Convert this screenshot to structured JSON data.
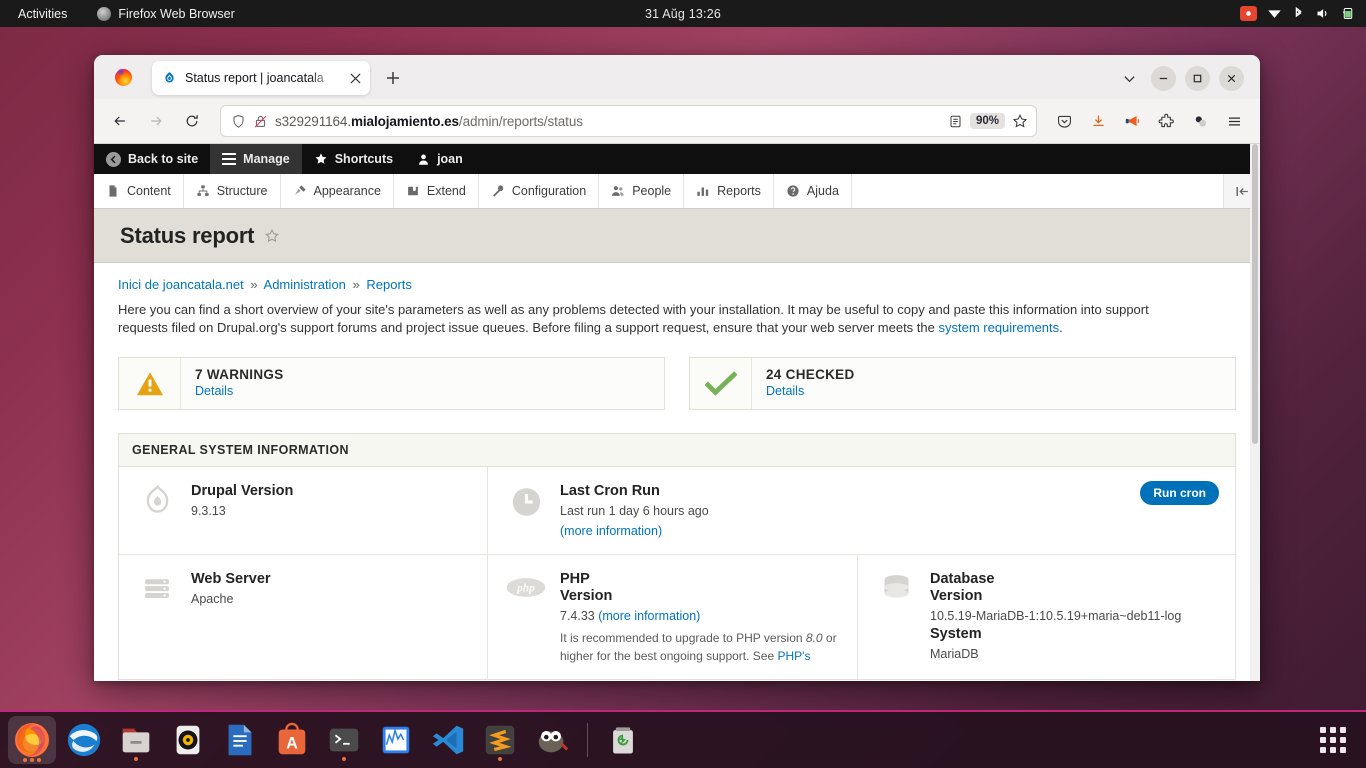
{
  "topbar": {
    "activities": "Activities",
    "app_name": "Firefox Web Browser",
    "clock": "31 Aŭg  13:26",
    "icons": [
      "record-indicator-icon",
      "wifi-icon",
      "bluetooth-icon",
      "volume-icon",
      "battery-icon"
    ]
  },
  "browser": {
    "tab": {
      "title": "Status report | joancatala",
      "favicon": "drupal-favicon"
    },
    "newtab_label": "+",
    "url": {
      "subdomain": "s329291164.",
      "domain": "mialojamiento.es",
      "path": "/admin/reports/status"
    },
    "zoom": "90%",
    "nav_icons": [
      "back-icon",
      "forward-icon",
      "reload-icon"
    ],
    "urlbar_icons": [
      "shield-icon",
      "lock-crossed-icon",
      "reader-view-icon",
      "bookmark-star-icon"
    ],
    "toolbar_icons": [
      "pocket-icon",
      "downloads-icon",
      "megaphone-icon",
      "extensions-icon",
      "container-icon",
      "app-menu-icon"
    ],
    "window_controls": [
      "list-all-tabs-icon",
      "minimize-button",
      "maximize-button",
      "close-button"
    ]
  },
  "drupal_toolbar": {
    "back_to_site": "Back to site",
    "manage": "Manage",
    "shortcuts": "Shortcuts",
    "user": "joan",
    "menu": [
      {
        "label": "Content",
        "icon": "content-icon"
      },
      {
        "label": "Structure",
        "icon": "structure-icon"
      },
      {
        "label": "Appearance",
        "icon": "appearance-icon"
      },
      {
        "label": "Extend",
        "icon": "extend-icon"
      },
      {
        "label": "Configuration",
        "icon": "configuration-icon"
      },
      {
        "label": "People",
        "icon": "people-icon"
      },
      {
        "label": "Reports",
        "icon": "reports-icon"
      },
      {
        "label": "Ajuda",
        "icon": "help-icon"
      }
    ]
  },
  "page": {
    "title": "Status report",
    "breadcrumb": {
      "home": "Inici de joancatala.net",
      "admin": "Administration",
      "section": "Reports",
      "separator": "»"
    },
    "intro_part1": "Here you can find a short overview of your site's parameters as well as any problems detected with your installation. It may be useful to copy and paste this information into support requests filed on Drupal.org's support forums and project issue queues. Before filing a support request, ensure that your web server meets the ",
    "intro_link": "system requirements",
    "intro_part2": ".",
    "summary": [
      {
        "title": "7 WARNINGS",
        "link": "Details",
        "icon": "warning-icon",
        "color": "#e5a313"
      },
      {
        "title": "24 CHECKED",
        "link": "Details",
        "icon": "check-icon",
        "color": "#77b259"
      }
    ],
    "general": {
      "heading": "GENERAL SYSTEM INFORMATION",
      "drupal": {
        "title": "Drupal Version",
        "value": "9.3.13",
        "icon": "drupal-icon"
      },
      "cron": {
        "title": "Last Cron Run",
        "value": "Last run 1 day 6 hours ago",
        "link": "(more information)",
        "button": "Run cron",
        "icon": "clock-icon"
      },
      "webserver": {
        "title": "Web Server",
        "value": "Apache",
        "icon": "server-icon"
      },
      "php": {
        "title_line1": "PHP",
        "title_line2": "Version",
        "value": "7.4.33 ",
        "link": "(more information)",
        "note_part1": "It is recommended to upgrade to PHP version ",
        "note_em": "8.0",
        "note_part2": " or higher for the best ongoing support. See ",
        "note_link": "PHP's",
        "icon": "php-icon"
      },
      "database": {
        "title_line1": "Database",
        "title_line2": "Version",
        "value": "10.5.19-MariaDB-1:10.5.19+maria~deb11-log",
        "system_label": "System",
        "system_value": "MariaDB",
        "icon": "database-icon"
      }
    }
  },
  "dock": {
    "items": [
      {
        "name": "firefox",
        "running": true
      },
      {
        "name": "thunderbird",
        "running": false
      },
      {
        "name": "files",
        "running": true
      },
      {
        "name": "rhythmbox",
        "running": false
      },
      {
        "name": "libreoffice-writer",
        "running": false
      },
      {
        "name": "ubuntu-software",
        "running": false
      },
      {
        "name": "terminal",
        "running": true
      },
      {
        "name": "system-monitor",
        "running": false
      },
      {
        "name": "vscode",
        "running": false
      },
      {
        "name": "sublime-text",
        "running": true
      },
      {
        "name": "gimp",
        "running": false
      },
      {
        "name": "trash",
        "running": false
      }
    ],
    "apps_label": "Show Applications"
  }
}
